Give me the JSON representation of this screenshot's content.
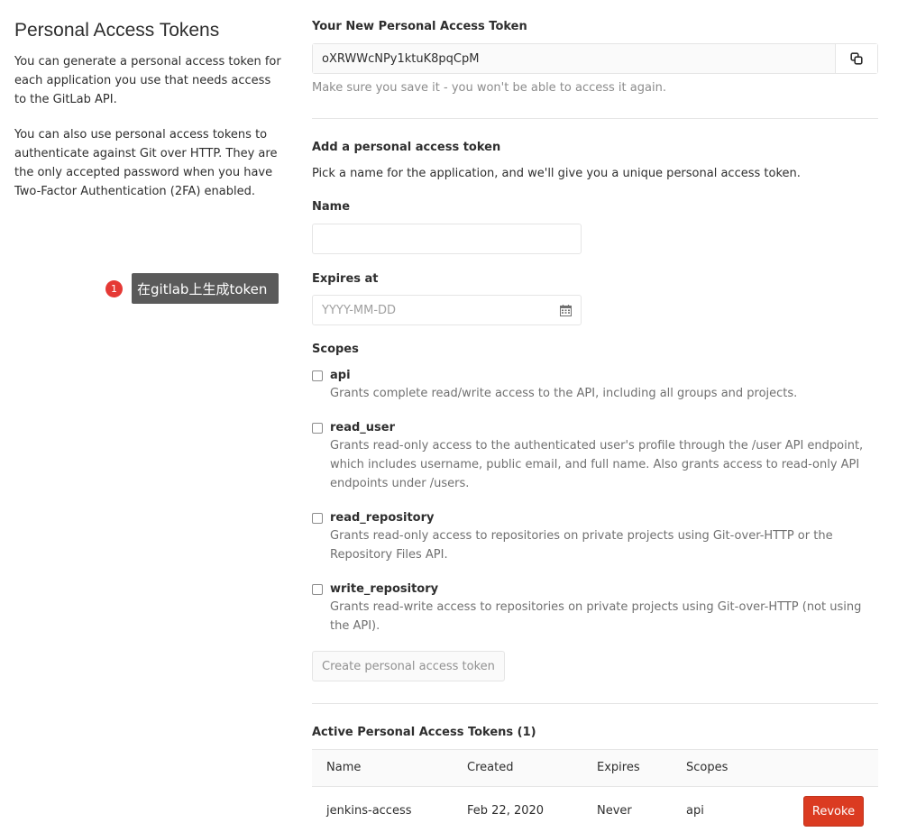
{
  "left": {
    "title": "Personal Access Tokens",
    "para1": "You can generate a personal access token for each application you use that needs access to the GitLab API.",
    "para2": "You can also use personal access tokens to authenticate against Git over HTTP. They are the only accepted password when you have Two-Factor Authentication (2FA) enabled."
  },
  "annotation": {
    "number": "1",
    "text": "在gitlab上生成token"
  },
  "new_token": {
    "title": "Your New Personal Access Token",
    "value": "oXRWWcNPy1ktuK8pqCpM",
    "hint": "Make sure you save it - you won't be able to access it again.",
    "copy_icon": "copy-icon"
  },
  "form": {
    "title": "Add a personal access token",
    "description": "Pick a name for the application, and we'll give you a unique personal access token.",
    "name_label": "Name",
    "name_value": "",
    "expires_label": "Expires at",
    "expires_placeholder": "YYYY-MM-DD",
    "scopes_label": "Scopes",
    "scopes": [
      {
        "name": "api",
        "description": "Grants complete read/write access to the API, including all groups and projects."
      },
      {
        "name": "read_user",
        "description": "Grants read-only access to the authenticated user's profile through the /user API endpoint, which includes username, public email, and full name. Also grants access to read-only API endpoints under /users."
      },
      {
        "name": "read_repository",
        "description": "Grants read-only access to repositories on private projects using Git-over-HTTP or the Repository Files API."
      },
      {
        "name": "write_repository",
        "description": "Grants read-write access to repositories on private projects using Git-over-HTTP (not using the API)."
      }
    ],
    "create_label": "Create personal access token"
  },
  "active": {
    "title": "Active Personal Access Tokens (1)",
    "columns": [
      "Name",
      "Created",
      "Expires",
      "Scopes"
    ],
    "rows": [
      {
        "name": "jenkins-access",
        "created": "Feb 22, 2020",
        "expires": "Never",
        "scopes": "api",
        "action": "Revoke"
      }
    ]
  },
  "colors": {
    "revoke": "#db3b21",
    "annotation_badge": "#e53935",
    "annotation_bubble": "#5a5a5a"
  }
}
